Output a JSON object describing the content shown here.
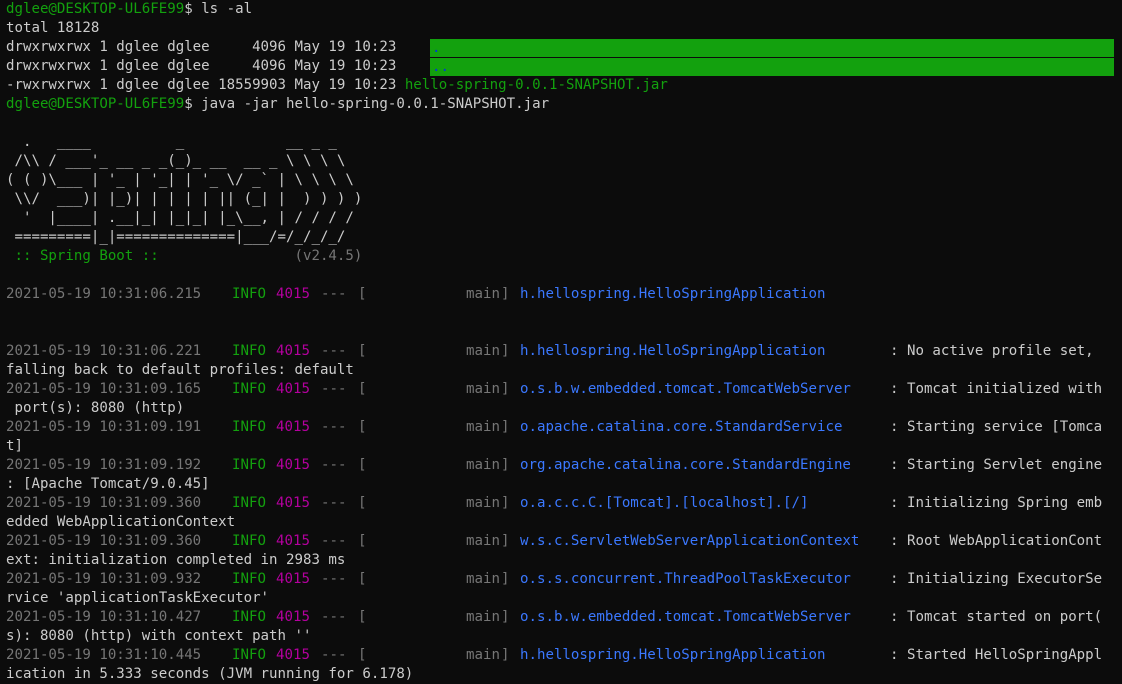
{
  "terminal": {
    "prompt": "dglee@DESKTOP-UL6FE99",
    "prompt_suffix": "$ ",
    "cmd1": "ls -al",
    "total": "total 18128",
    "listing": [
      {
        "perms": "drwxrwxrwx 1 dglee dglee     4096 May 19 10:23 ",
        "name": "."
      },
      {
        "perms": "drwxrwxrwx 1 dglee dglee     4096 May 19 10:23 ",
        "name": ".."
      },
      {
        "perms": "-rwxrwxrwx 1 dglee dglee 18559903 May 19 10:23 ",
        "name": "hello-spring-0.0.1-SNAPSHOT.jar"
      }
    ],
    "cmd2": "java -jar hello-spring-0.0.1-SNAPSHOT.jar"
  },
  "banner": {
    "art": [
      "  .   ____          _            __ _ _",
      " /\\\\ / ___'_ __ _ _(_)_ __  __ _ \\ \\ \\ \\",
      "( ( )\\___ | '_ | '_| | '_ \\/ _` | \\ \\ \\ \\",
      " \\\\/  ___)| |_)| | | | | || (_| |  ) ) ) )",
      "  '  |____| .__|_| |_|_| |_\\__, | / / / /",
      " =========|_|==============|___/=/_/_/_/"
    ],
    "spring_label": " :: Spring Boot :: ",
    "version": "               (v2.4.5)"
  },
  "logs": [
    {
      "ts": "2021-05-19 10:31:06.215",
      "level": "INFO",
      "pid": "4015",
      "dashes": "---",
      "thread": "main",
      "logger": "h.hellospring.HelloSpringApplication",
      "msg": "",
      "cont": ""
    },
    {
      "ts": "2021-05-19 10:31:06.221",
      "level": "INFO",
      "pid": "4015",
      "dashes": "---",
      "thread": "main",
      "logger": "h.hellospring.HelloSpringApplication",
      "msg": ": No active profile set,",
      "cont": "falling back to default profiles: default"
    },
    {
      "ts": "2021-05-19 10:31:09.165",
      "level": "INFO",
      "pid": "4015",
      "dashes": "---",
      "thread": "main",
      "logger": "o.s.b.w.embedded.tomcat.TomcatWebServer",
      "msg": ": Tomcat initialized with",
      "cont": " port(s): 8080 (http)"
    },
    {
      "ts": "2021-05-19 10:31:09.191",
      "level": "INFO",
      "pid": "4015",
      "dashes": "---",
      "thread": "main",
      "logger": "o.apache.catalina.core.StandardService",
      "msg": ": Starting service [Tomca",
      "cont": "t]"
    },
    {
      "ts": "2021-05-19 10:31:09.192",
      "level": "INFO",
      "pid": "4015",
      "dashes": "---",
      "thread": "main",
      "logger": "org.apache.catalina.core.StandardEngine",
      "msg": ": Starting Servlet engine",
      "cont": ": [Apache Tomcat/9.0.45]"
    },
    {
      "ts": "2021-05-19 10:31:09.360",
      "level": "INFO",
      "pid": "4015",
      "dashes": "---",
      "thread": "main",
      "logger": "o.a.c.c.C.[Tomcat].[localhost].[/]",
      "msg": ": Initializing Spring emb",
      "cont": "edded WebApplicationContext"
    },
    {
      "ts": "2021-05-19 10:31:09.360",
      "level": "INFO",
      "pid": "4015",
      "dashes": "---",
      "thread": "main",
      "logger": "w.s.c.ServletWebServerApplicationContext",
      "msg": ": Root WebApplicationCont",
      "cont": "ext: initialization completed in 2983 ms"
    },
    {
      "ts": "2021-05-19 10:31:09.932",
      "level": "INFO",
      "pid": "4015",
      "dashes": "---",
      "thread": "main",
      "logger": "o.s.s.concurrent.ThreadPoolTaskExecutor",
      "msg": ": Initializing ExecutorSe",
      "cont": "rvice 'applicationTaskExecutor'"
    },
    {
      "ts": "2021-05-19 10:31:10.427",
      "level": "INFO",
      "pid": "4015",
      "dashes": "---",
      "thread": "main",
      "logger": "o.s.b.w.embedded.tomcat.TomcatWebServer",
      "msg": ": Tomcat started on port(",
      "cont": "s): 8080 (http) with context path ''"
    },
    {
      "ts": "2021-05-19 10:31:10.445",
      "level": "INFO",
      "pid": "4015",
      "dashes": "---",
      "thread": "main",
      "logger": "h.hellospring.HelloSpringApplication",
      "msg": ": Started HelloSpringAppl",
      "cont": "ication in 5.333 seconds (JVM running for 6.178)"
    }
  ],
  "colors": {
    "background": "#0c0c0c",
    "text": "#cccccc",
    "green": "#13a10e",
    "blue": "#3b78ff",
    "magenta": "#b4009e",
    "gray": "#767676"
  }
}
